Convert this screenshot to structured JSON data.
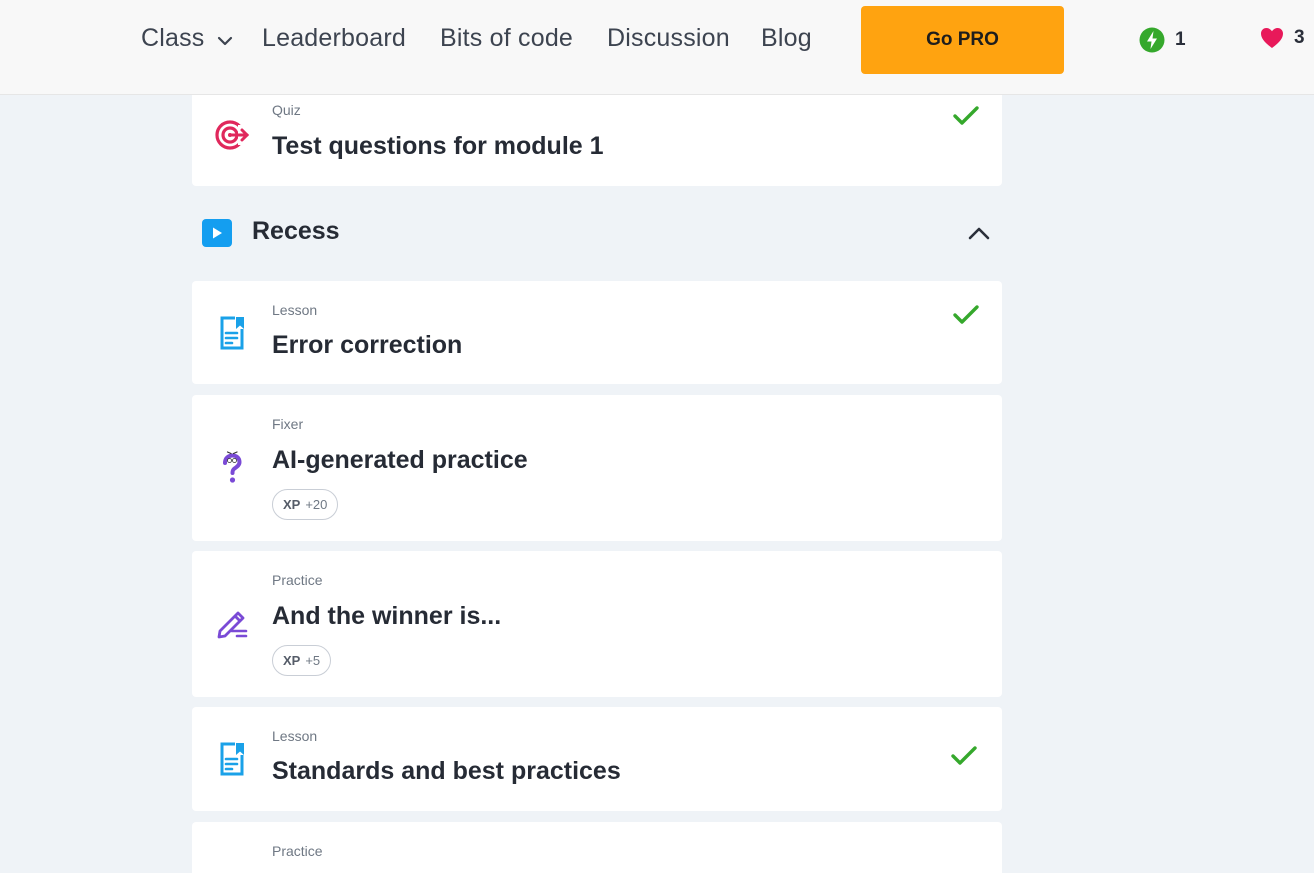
{
  "nav": {
    "class_label": "Class",
    "leaderboard_label": "Leaderboard",
    "bits_label": "Bits of code",
    "discussion_label": "Discussion",
    "blog_label": "Blog",
    "go_pro_label": "Go PRO",
    "energy_count": "1",
    "hearts_count": "3"
  },
  "colors": {
    "accent": "#ffa310",
    "success": "#35a82c",
    "quiz": "#e0285c",
    "lesson": "#1aa1e8",
    "practice": "#7a4ad6"
  },
  "items": [
    {
      "type": "Quiz",
      "title": "Test questions for module 1",
      "icon": "target-icon",
      "completed": true
    },
    {
      "type": "Lesson",
      "title": "Error correction",
      "icon": "lesson-doc-icon",
      "completed": true
    },
    {
      "type": "Fixer",
      "title": "AI-generated practice",
      "icon": "question-mark-icon",
      "completed": false,
      "xp_label": "XP",
      "xp_value": "+20"
    },
    {
      "type": "Practice",
      "title": "And the winner is...",
      "icon": "pencil-icon",
      "completed": false,
      "xp_label": "XP",
      "xp_value": "+5"
    },
    {
      "type": "Lesson",
      "title": "Standards and best practices",
      "icon": "lesson-doc-icon",
      "completed": true
    },
    {
      "type": "Practice",
      "title": "",
      "icon": "",
      "completed": false
    }
  ],
  "section": {
    "title": "Recess",
    "icon": "play-icon",
    "expanded": true
  }
}
